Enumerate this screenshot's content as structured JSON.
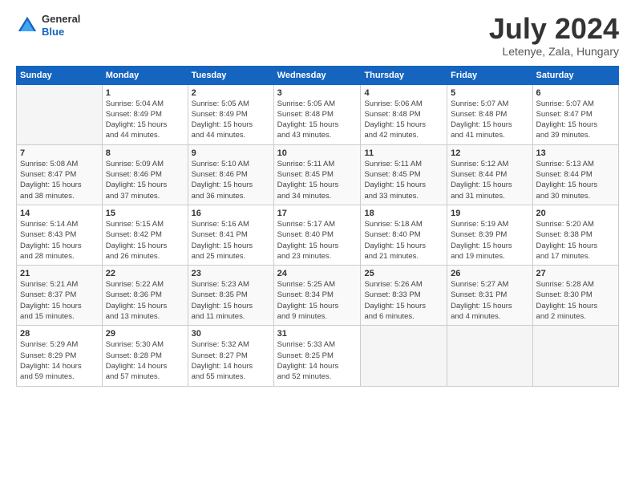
{
  "header": {
    "logo": {
      "general": "General",
      "blue": "Blue"
    },
    "title": "July 2024",
    "location": "Letenye, Zala, Hungary"
  },
  "days_of_week": [
    "Sunday",
    "Monday",
    "Tuesday",
    "Wednesday",
    "Thursday",
    "Friday",
    "Saturday"
  ],
  "weeks": [
    [
      {
        "day": "",
        "info": ""
      },
      {
        "day": "1",
        "info": "Sunrise: 5:04 AM\nSunset: 8:49 PM\nDaylight: 15 hours\nand 44 minutes."
      },
      {
        "day": "2",
        "info": "Sunrise: 5:05 AM\nSunset: 8:49 PM\nDaylight: 15 hours\nand 44 minutes."
      },
      {
        "day": "3",
        "info": "Sunrise: 5:05 AM\nSunset: 8:48 PM\nDaylight: 15 hours\nand 43 minutes."
      },
      {
        "day": "4",
        "info": "Sunrise: 5:06 AM\nSunset: 8:48 PM\nDaylight: 15 hours\nand 42 minutes."
      },
      {
        "day": "5",
        "info": "Sunrise: 5:07 AM\nSunset: 8:48 PM\nDaylight: 15 hours\nand 41 minutes."
      },
      {
        "day": "6",
        "info": "Sunrise: 5:07 AM\nSunset: 8:47 PM\nDaylight: 15 hours\nand 39 minutes."
      }
    ],
    [
      {
        "day": "7",
        "info": "Sunrise: 5:08 AM\nSunset: 8:47 PM\nDaylight: 15 hours\nand 38 minutes."
      },
      {
        "day": "8",
        "info": "Sunrise: 5:09 AM\nSunset: 8:46 PM\nDaylight: 15 hours\nand 37 minutes."
      },
      {
        "day": "9",
        "info": "Sunrise: 5:10 AM\nSunset: 8:46 PM\nDaylight: 15 hours\nand 36 minutes."
      },
      {
        "day": "10",
        "info": "Sunrise: 5:11 AM\nSunset: 8:45 PM\nDaylight: 15 hours\nand 34 minutes."
      },
      {
        "day": "11",
        "info": "Sunrise: 5:11 AM\nSunset: 8:45 PM\nDaylight: 15 hours\nand 33 minutes."
      },
      {
        "day": "12",
        "info": "Sunrise: 5:12 AM\nSunset: 8:44 PM\nDaylight: 15 hours\nand 31 minutes."
      },
      {
        "day": "13",
        "info": "Sunrise: 5:13 AM\nSunset: 8:44 PM\nDaylight: 15 hours\nand 30 minutes."
      }
    ],
    [
      {
        "day": "14",
        "info": "Sunrise: 5:14 AM\nSunset: 8:43 PM\nDaylight: 15 hours\nand 28 minutes."
      },
      {
        "day": "15",
        "info": "Sunrise: 5:15 AM\nSunset: 8:42 PM\nDaylight: 15 hours\nand 26 minutes."
      },
      {
        "day": "16",
        "info": "Sunrise: 5:16 AM\nSunset: 8:41 PM\nDaylight: 15 hours\nand 25 minutes."
      },
      {
        "day": "17",
        "info": "Sunrise: 5:17 AM\nSunset: 8:40 PM\nDaylight: 15 hours\nand 23 minutes."
      },
      {
        "day": "18",
        "info": "Sunrise: 5:18 AM\nSunset: 8:40 PM\nDaylight: 15 hours\nand 21 minutes."
      },
      {
        "day": "19",
        "info": "Sunrise: 5:19 AM\nSunset: 8:39 PM\nDaylight: 15 hours\nand 19 minutes."
      },
      {
        "day": "20",
        "info": "Sunrise: 5:20 AM\nSunset: 8:38 PM\nDaylight: 15 hours\nand 17 minutes."
      }
    ],
    [
      {
        "day": "21",
        "info": "Sunrise: 5:21 AM\nSunset: 8:37 PM\nDaylight: 15 hours\nand 15 minutes."
      },
      {
        "day": "22",
        "info": "Sunrise: 5:22 AM\nSunset: 8:36 PM\nDaylight: 15 hours\nand 13 minutes."
      },
      {
        "day": "23",
        "info": "Sunrise: 5:23 AM\nSunset: 8:35 PM\nDaylight: 15 hours\nand 11 minutes."
      },
      {
        "day": "24",
        "info": "Sunrise: 5:25 AM\nSunset: 8:34 PM\nDaylight: 15 hours\nand 9 minutes."
      },
      {
        "day": "25",
        "info": "Sunrise: 5:26 AM\nSunset: 8:33 PM\nDaylight: 15 hours\nand 6 minutes."
      },
      {
        "day": "26",
        "info": "Sunrise: 5:27 AM\nSunset: 8:31 PM\nDaylight: 15 hours\nand 4 minutes."
      },
      {
        "day": "27",
        "info": "Sunrise: 5:28 AM\nSunset: 8:30 PM\nDaylight: 15 hours\nand 2 minutes."
      }
    ],
    [
      {
        "day": "28",
        "info": "Sunrise: 5:29 AM\nSunset: 8:29 PM\nDaylight: 14 hours\nand 59 minutes."
      },
      {
        "day": "29",
        "info": "Sunrise: 5:30 AM\nSunset: 8:28 PM\nDaylight: 14 hours\nand 57 minutes."
      },
      {
        "day": "30",
        "info": "Sunrise: 5:32 AM\nSunset: 8:27 PM\nDaylight: 14 hours\nand 55 minutes."
      },
      {
        "day": "31",
        "info": "Sunrise: 5:33 AM\nSunset: 8:25 PM\nDaylight: 14 hours\nand 52 minutes."
      },
      {
        "day": "",
        "info": ""
      },
      {
        "day": "",
        "info": ""
      },
      {
        "day": "",
        "info": ""
      }
    ]
  ]
}
